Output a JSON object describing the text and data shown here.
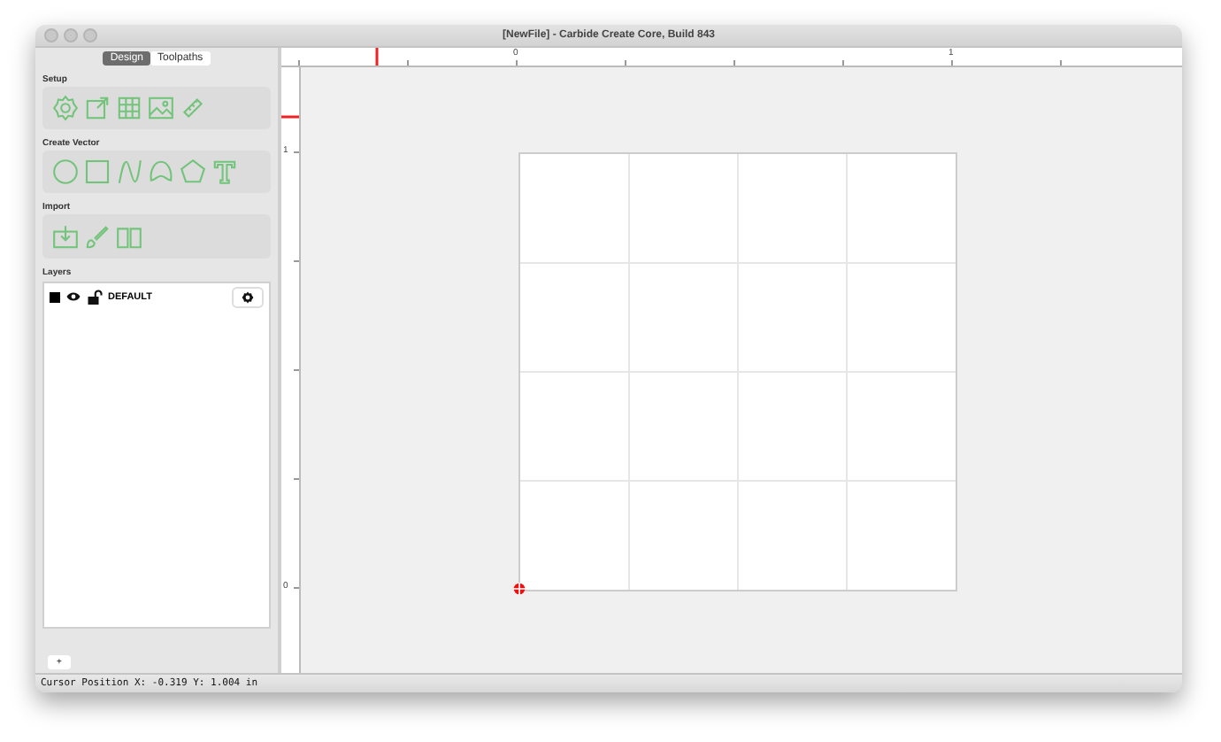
{
  "window": {
    "title": "[NewFile] - Carbide Create Core, Build 843"
  },
  "tabs": [
    {
      "label": "Design",
      "selected": true
    },
    {
      "label": "Toolpaths",
      "selected": false
    }
  ],
  "sections": [
    {
      "title": "Setup",
      "tools": [
        {
          "kind": "gear"
        },
        {
          "kind": "export"
        },
        {
          "kind": "grid"
        },
        {
          "kind": "image"
        },
        {
          "kind": "ruler"
        }
      ]
    },
    {
      "title": "Create Vector",
      "tools": [
        {
          "kind": "circle"
        },
        {
          "kind": "rectangle"
        },
        {
          "kind": "curve"
        },
        {
          "kind": "arch"
        },
        {
          "kind": "polygon"
        },
        {
          "kind": "text"
        }
      ]
    },
    {
      "title": "Import",
      "tools": [
        {
          "kind": "import"
        },
        {
          "kind": "brush"
        },
        {
          "kind": "book"
        }
      ]
    }
  ],
  "layers": {
    "title": "Layers",
    "items": [
      {
        "name": "DEFAULT",
        "color": "#000000",
        "visible": true,
        "locked": false
      }
    ],
    "add_button": "+"
  },
  "rulers": {
    "x_labels": [
      "0",
      "1"
    ],
    "y_labels": [
      "1",
      "0"
    ]
  },
  "status_bar": "Cursor Position X: -0.319 Y: 1.004 in"
}
